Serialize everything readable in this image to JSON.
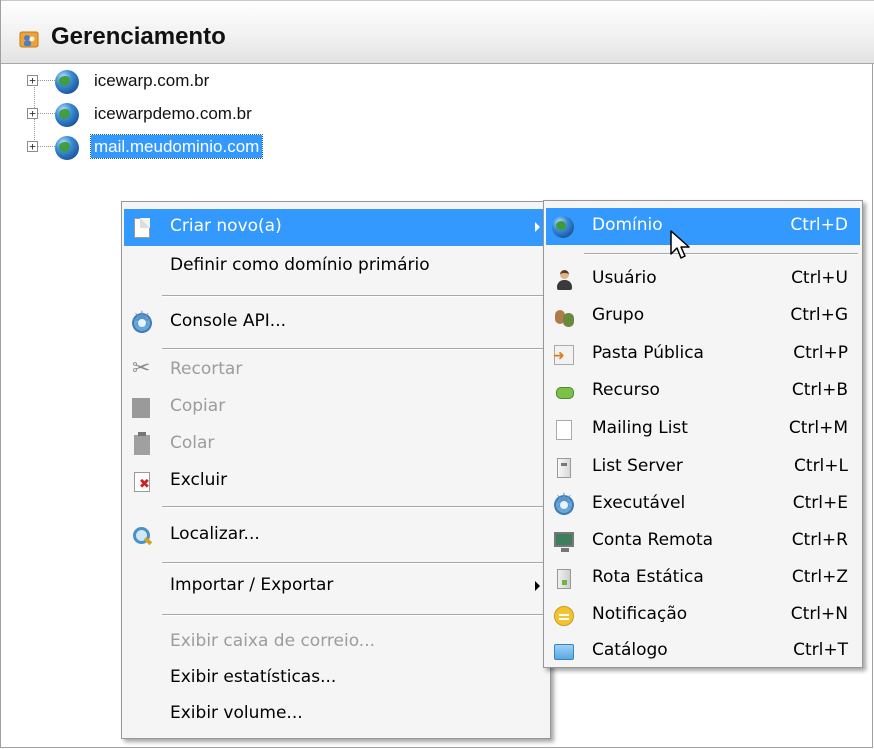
{
  "header": {
    "title": "Gerenciamento",
    "icon": "folder-people-icon"
  },
  "tree": {
    "items": [
      {
        "label": "icewarp.com.br",
        "icon": "globe-icon",
        "expander": "+"
      },
      {
        "label": "icewarpdemo.com.br",
        "icon": "globe-icon",
        "expander": "+"
      },
      {
        "label": "mail.meudominio.com",
        "icon": "globe-icon",
        "expander": "+",
        "selected": true
      }
    ]
  },
  "context_menu": {
    "items": [
      {
        "label": "Criar novo(a)",
        "icon": "document-icon",
        "submenu": true,
        "highlighted": true
      },
      {
        "label": "Definir como domínio primário"
      },
      {
        "label": "Console API...",
        "icon": "gear-icon"
      },
      {
        "label": "Recortar",
        "icon": "cut-icon",
        "disabled": true
      },
      {
        "label": "Copiar",
        "icon": "copy-icon",
        "disabled": true
      },
      {
        "label": "Colar",
        "icon": "paste-icon",
        "disabled": true
      },
      {
        "label": "Excluir",
        "icon": "delete-icon"
      },
      {
        "label": "Localizar...",
        "icon": "search-icon"
      },
      {
        "label": "Importar / Exportar",
        "submenu": true
      },
      {
        "label": "Exibir caixa de correio...",
        "disabled": true
      },
      {
        "label": "Exibir estatísticas..."
      },
      {
        "label": "Exibir volume..."
      }
    ]
  },
  "submenu": {
    "items": [
      {
        "label": "Domínio",
        "shortcut": "Ctrl+D",
        "icon": "globe-icon",
        "highlighted": true
      },
      {
        "label": "Usuário",
        "shortcut": "Ctrl+U",
        "icon": "user-icon"
      },
      {
        "label": "Grupo",
        "shortcut": "Ctrl+G",
        "icon": "group-icon"
      },
      {
        "label": "Pasta Pública",
        "shortcut": "Ctrl+P",
        "icon": "public-folder-icon"
      },
      {
        "label": "Recurso",
        "shortcut": "Ctrl+B",
        "icon": "resource-icon"
      },
      {
        "label": "Mailing List",
        "shortcut": "Ctrl+M",
        "icon": "page-icon"
      },
      {
        "label": "List Server",
        "shortcut": "Ctrl+L",
        "icon": "server-icon"
      },
      {
        "label": "Executável",
        "shortcut": "Ctrl+E",
        "icon": "gear-icon"
      },
      {
        "label": "Conta Remota",
        "shortcut": "Ctrl+R",
        "icon": "monitor-icon"
      },
      {
        "label": "Rota Estática",
        "shortcut": "Ctrl+Z",
        "icon": "route-icon"
      },
      {
        "label": "Notificação",
        "shortcut": "Ctrl+N",
        "icon": "notification-icon"
      },
      {
        "label": "Catálogo",
        "shortcut": "Ctrl+T",
        "icon": "folder-icon"
      }
    ]
  },
  "colors": {
    "highlight": "#3399ff",
    "menu_bg": "#f5f5f5",
    "disabled_text": "#9c9c9c"
  }
}
